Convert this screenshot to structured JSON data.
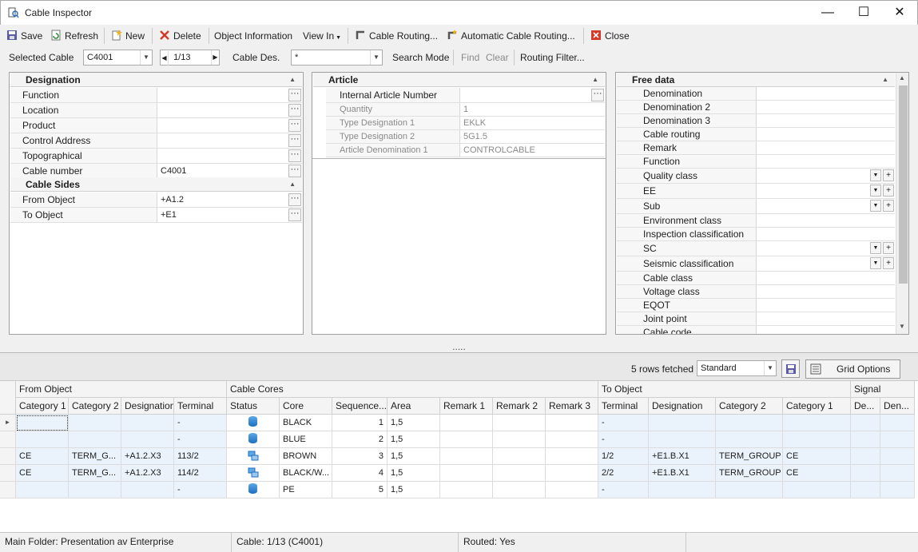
{
  "window": {
    "title": "Cable Inspector"
  },
  "toolbar": {
    "save": "Save",
    "refresh": "Refresh",
    "new": "New",
    "delete": "Delete",
    "object_information": "Object Information",
    "view_in": "View In",
    "cable_routing": "Cable Routing...",
    "auto_cable_routing": "Automatic Cable Routing...",
    "close": "Close"
  },
  "selection": {
    "selected_cable_label": "Selected Cable",
    "selected_cable_value": "C4001",
    "page_value": "1/13",
    "cable_des_label": "Cable Des.",
    "cable_des_value": "*",
    "search_mode": "Search Mode",
    "find": "Find",
    "clear": "Clear",
    "routing_filter": "Routing Filter..."
  },
  "designation_panel": {
    "title": "Designation",
    "rows": [
      {
        "label": "Function",
        "value": ""
      },
      {
        "label": "Location",
        "value": ""
      },
      {
        "label": "Product",
        "value": ""
      },
      {
        "label": "Control Address",
        "value": ""
      },
      {
        "label": "Topographical",
        "value": ""
      },
      {
        "label": "Cable number",
        "value": "C4001"
      }
    ],
    "sides_title": "Cable Sides",
    "sides": [
      {
        "label": "From Object",
        "value": "+A1.2"
      },
      {
        "label": "To Object",
        "value": "+E1"
      }
    ]
  },
  "article_panel": {
    "title": "Article",
    "rows": [
      {
        "label": "Internal Article Number",
        "value": ""
      },
      {
        "label": "Quantity",
        "value": "1"
      },
      {
        "label": "Type Designation 1",
        "value": "EKLK"
      },
      {
        "label": "Type Designation 2",
        "value": "5G1.5"
      },
      {
        "label": "Article Denomination 1",
        "value": "CONTROLCABLE"
      }
    ]
  },
  "free_data_panel": {
    "title": "Free data",
    "rows": [
      "Denomination",
      "Denomination 2",
      "Denomination 3",
      "Cable routing",
      "Remark",
      "Function",
      "Quality class",
      "EE",
      "Sub",
      "Environment class",
      "Inspection classification",
      "SC",
      "Seismic classification",
      "Cable class",
      "Voltage class",
      "EQOT",
      "Joint point",
      "Cable code"
    ]
  },
  "grid_toolbar": {
    "rows_fetched": "5 rows fetched",
    "layout": "Standard",
    "grid_options": "Grid Options",
    "splitter": "....."
  },
  "grid": {
    "groups": [
      "From Object",
      "Cable Cores",
      "To Object",
      "Signal"
    ],
    "columns": [
      "Category 1",
      "Category 2",
      "Designation",
      "Terminal",
      "Status",
      "Core",
      "Sequence...",
      "Area",
      "Remark 1",
      "Remark 2",
      "Remark 3",
      "Terminal",
      "Designation",
      "Category 2",
      "Category 1",
      "De...",
      "Den..."
    ],
    "rows": [
      [
        "",
        "",
        "",
        "-",
        "",
        "BLACK",
        "1",
        "1,5",
        "",
        "",
        "",
        "-",
        "",
        "",
        "",
        "",
        ""
      ],
      [
        "",
        "",
        "",
        "-",
        "",
        "BLUE",
        "2",
        "1,5",
        "",
        "",
        "",
        "-",
        "",
        "",
        "",
        "",
        ""
      ],
      [
        "CE",
        "TERM_G...",
        "+A1.2.X3",
        "113/2",
        "",
        "BROWN",
        "3",
        "1,5",
        "",
        "",
        "",
        "1/2",
        "+E1.B.X1",
        "TERM_GROUP",
        "CE",
        "",
        ""
      ],
      [
        "CE",
        "TERM_G...",
        "+A1.2.X3",
        "114/2",
        "",
        "BLACK/W...",
        "4",
        "1,5",
        "",
        "",
        "",
        "2/2",
        "+E1.B.X1",
        "TERM_GROUP",
        "CE",
        "",
        ""
      ],
      [
        "",
        "",
        "",
        "-",
        "",
        "PE",
        "5",
        "1,5",
        "",
        "",
        "",
        "-",
        "",
        "",
        "",
        "",
        ""
      ]
    ]
  },
  "status_bar": {
    "main_folder": "Main Folder: Presentation av Enterprise",
    "cable": "Cable: 1/13 (C4001)",
    "routed": "Routed: Yes"
  }
}
